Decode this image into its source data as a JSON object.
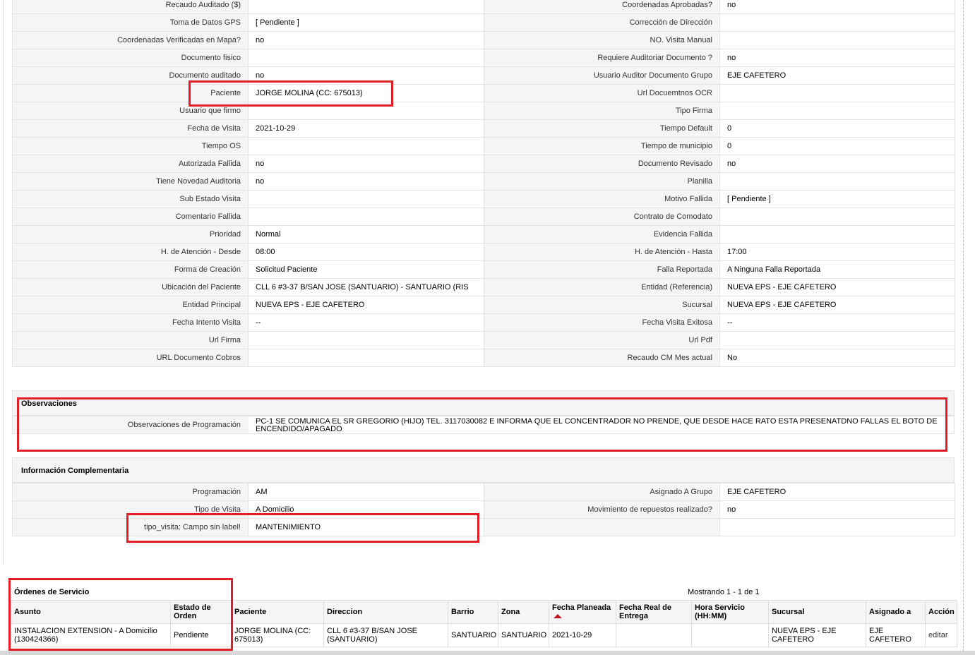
{
  "details": [
    [
      "Recaudo Auditado ($)",
      "",
      "Coordenadas Aprobadas?",
      "no"
    ],
    [
      "Toma de Datos GPS",
      "[ Pendiente ]",
      "Corrección de Dirección",
      ""
    ],
    [
      "Coordenadas Verificadas en Mapa?",
      "no",
      "NO. Visita Manual",
      ""
    ],
    [
      "Documento fisico",
      "",
      "Requiere Auditoriar Documento ?",
      "no"
    ],
    [
      "Documento auditado",
      "no",
      "Usuario Auditor Documento Grupo",
      "EJE CAFETERO"
    ],
    [
      "Paciente",
      "JORGE MOLINA (CC: 675013)",
      "Url Docuemtnos OCR",
      ""
    ],
    [
      "Usuario que firmo",
      "",
      "Tipo Firma",
      ""
    ],
    [
      "Fecha de Visita",
      "2021-10-29",
      "Tiempo Default",
      "0"
    ],
    [
      "Tiempo OS",
      "",
      "Tiempo de municipio",
      "0"
    ],
    [
      "Autorizada Fallida",
      "no",
      "Documento Revisado",
      "no"
    ],
    [
      "Tiene Novedad Auditoria",
      "no",
      "Planilla",
      ""
    ],
    [
      "Sub Estado Visita",
      "",
      "Motivo Fallida",
      "[ Pendiente ]"
    ],
    [
      "Comentario Fallida",
      "",
      "Contrato de Comodato",
      ""
    ],
    [
      "Prioridad",
      "Normal",
      "Evidencia Fallida",
      ""
    ],
    [
      "H. de Atención - Desde",
      "08:00",
      "H. de Atención - Hasta",
      "17:00"
    ],
    [
      "Forma de Creación",
      "Solicitud Paciente",
      "Falla Reportada",
      "A Ninguna Falla Reportada"
    ],
    [
      "Ubicación del Paciente",
      "CLL 6 #3-37 B/SAN JOSE (SANTUARIO) - SANTUARIO (RIS",
      "Entidad (Referencia)",
      "NUEVA EPS - EJE CAFETERO"
    ],
    [
      "Entidad Principal",
      "NUEVA EPS - EJE CAFETERO",
      "Sucursal",
      "NUEVA EPS - EJE CAFETERO"
    ],
    [
      "Fecha Intento Visita",
      "--",
      "Fecha Visita Exitosa",
      "--"
    ],
    [
      "Url Firma",
      "",
      "Url Pdf",
      ""
    ],
    [
      "URL Documento Cobros",
      "",
      "Recaudo CM Mes actual",
      "No"
    ]
  ],
  "observaciones": {
    "title": "Observaciones",
    "label": "Observaciones de Programación",
    "value": "PC-1 SE COMUNICA EL SR GREGORIO (HIJO) TEL. 3117030082 E INFORMA QUE EL CONCENTRADOR NO PRENDE, QUE DESDE HACE RATO ESTA PRESENATDNO FALLAS EL BOTO DE ENCENDIDO/APAGADO"
  },
  "complementaria": {
    "title": "Información Complementaria",
    "rows": [
      [
        "Programación",
        "AM",
        "Asignado A Grupo",
        "EJE CAFETERO"
      ],
      [
        "Tipo de Visita",
        "A Domicilio",
        "Movimiento de repuestos realizado?",
        "no"
      ],
      [
        "tipo_visita: Campo sin label!",
        "MANTENIMIENTO",
        "",
        ""
      ]
    ]
  },
  "orders": {
    "title": "Órdenes de Servicio",
    "count_text": "Mostrando 1 - 1 de 1",
    "headers": [
      "Asunto",
      "Estado de Orden",
      "Paciente",
      "Direccion",
      "Barrio",
      "Zona",
      "Fecha Planeada",
      "Fecha Real de Entrega",
      "Hora Servicio (HH:MM)",
      "Sucursal",
      "Asignado a",
      "Acción"
    ],
    "rows": [
      [
        "INSTALACION EXTENSION - A Domicilio (130424366)",
        "Pendiente",
        "JORGE MOLINA (CC: 675013)",
        "CLL 6 #3-37 B/SAN JOSE (SANTUARIO)",
        "SANTUARIO",
        "SANTUARIO",
        "2021-10-29",
        "",
        "",
        "NUEVA EPS - EJE CAFETERO",
        "EJE CAFETERO",
        "editar"
      ]
    ],
    "sorted_column": "Fecha Planeada",
    "sort_color": "#c0181f"
  },
  "highlight_color": "#e01e25"
}
